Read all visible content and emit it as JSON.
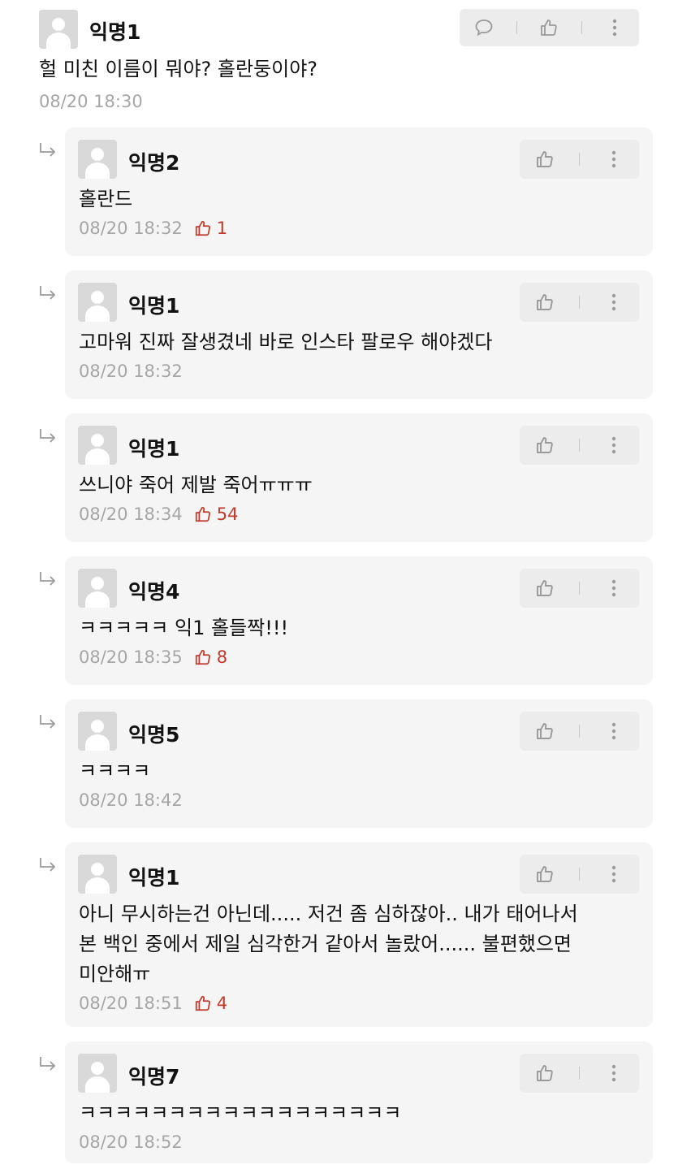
{
  "comment": {
    "nickname": "익명1",
    "text": "헐 미친 이름이 뭐야? 홀란둥이야?",
    "timestamp": "08/20 18:30",
    "icons": [
      "comment-icon",
      "thumbs-up-icon",
      "more-icon"
    ]
  },
  "replies": [
    {
      "nickname": "익명2",
      "text": "홀란드",
      "timestamp": "08/20 18:32",
      "likes": "1"
    },
    {
      "nickname": "익명1",
      "text": "고마워 진짜 잘생겼네 바로 인스타 팔로우 해야겠다",
      "timestamp": "08/20 18:32",
      "likes": null
    },
    {
      "nickname": "익명1",
      "text": "쓰니야 죽어 제발 죽어ㅠㅠㅠ",
      "timestamp": "08/20 18:34",
      "likes": "54"
    },
    {
      "nickname": "익명4",
      "text": "ㅋㅋㅋㅋㅋ 익1 홀들짝!!!",
      "timestamp": "08/20 18:35",
      "likes": "8"
    },
    {
      "nickname": "익명5",
      "text": "ㅋㅋㅋㅋ",
      "timestamp": "08/20 18:42",
      "likes": null
    },
    {
      "nickname": "익명1",
      "text": "아니 무시하는건 아닌데..... 저건 좀 심하잖아.. 내가 태어나서\n본 백인 중에서 제일 심각한거 같아서 놀랐어...... 불편했으면\n미안해ㅠ",
      "timestamp": "08/20 18:51",
      "likes": "4"
    },
    {
      "nickname": "익명7",
      "text": "ㅋㅋㅋㅋㅋㅋㅋㅋㅋㅋㅋㅋㅋㅋㅋㅋㅋㅋ",
      "timestamp": "08/20 18:52",
      "likes": null
    }
  ],
  "colors": {
    "like_red": "#c0392b",
    "meta_gray": "#a6a6a6",
    "box_bg": "#f5f5f5",
    "toolbar_bg": "#ececec"
  }
}
